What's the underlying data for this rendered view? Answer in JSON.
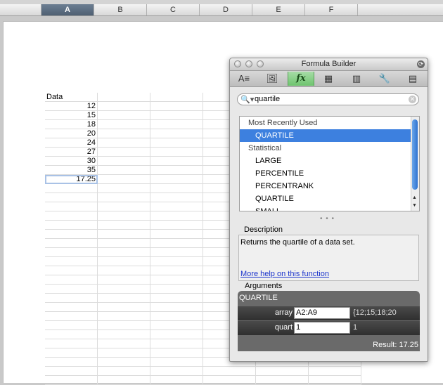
{
  "columns": [
    "A",
    "B",
    "C",
    "D",
    "E",
    "F"
  ],
  "active_column": "A",
  "sheet": {
    "cells": [
      "Data",
      "12",
      "15",
      "18",
      "20",
      "24",
      "27",
      "30",
      "35",
      "17.25"
    ]
  },
  "formula_builder": {
    "title": "Formula Builder",
    "toolbar": [
      {
        "icon": "text-box-icon",
        "glyph": "A≡"
      },
      {
        "icon": "add-image-icon",
        "glyph": "🖼"
      },
      {
        "icon": "fx-icon",
        "glyph": "fx"
      },
      {
        "icon": "media-icon",
        "glyph": "▦"
      },
      {
        "icon": "scrapbook-icon",
        "glyph": "▥"
      },
      {
        "icon": "tools-icon",
        "glyph": "🔧"
      },
      {
        "icon": "toolbox-icon",
        "glyph": "▤"
      }
    ],
    "search": {
      "value": "quartile"
    },
    "list": [
      {
        "label": "Most Recently Used",
        "type": "header"
      },
      {
        "label": "QUARTILE",
        "type": "fn",
        "selected": true
      },
      {
        "label": "Statistical",
        "type": "header"
      },
      {
        "label": "LARGE",
        "type": "fn"
      },
      {
        "label": "PERCENTILE",
        "type": "fn"
      },
      {
        "label": "PERCENTRANK",
        "type": "fn"
      },
      {
        "label": "QUARTILE",
        "type": "fn"
      },
      {
        "label": "SMALL",
        "type": "fn"
      }
    ],
    "description_label": "Description",
    "description": "Returns the quartile of a data set.",
    "help_link": "More help on this function",
    "arguments_label": "Arguments",
    "function_name": "QUARTILE",
    "args": [
      {
        "name": "array",
        "input": "A2:A9",
        "value": "{12;15;18;20"
      },
      {
        "name": "quart",
        "input": "1",
        "value": "1"
      }
    ],
    "result": "Result: 17.25"
  },
  "colors": {
    "accent": "#3d80df",
    "fx_active": "#6ec46e"
  }
}
